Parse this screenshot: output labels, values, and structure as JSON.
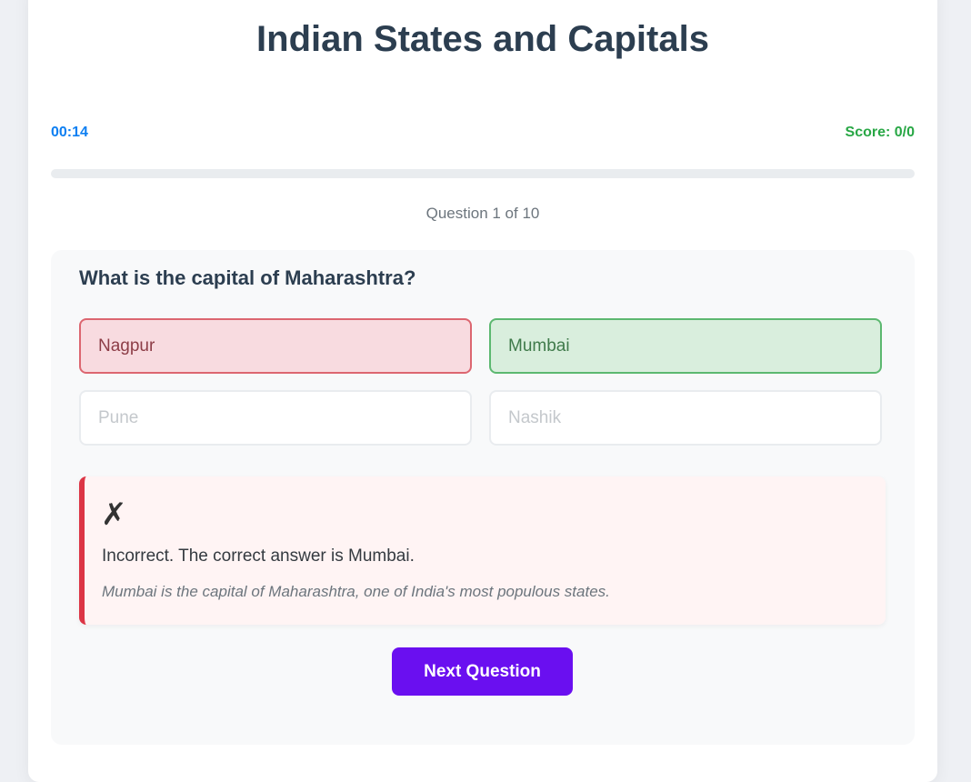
{
  "quiz": {
    "title": "Indian States and Capitals",
    "timer": "00:14",
    "score": "Score: 0/0",
    "progress": 0,
    "counter": "Question 1 of 10"
  },
  "question": {
    "text": "What is the capital of Maharashtra?",
    "options": [
      {
        "label": "Nagpur",
        "state": "incorrect"
      },
      {
        "label": "Mumbai",
        "state": "correct"
      },
      {
        "label": "Pune",
        "state": "disabled"
      },
      {
        "label": "Nashik",
        "state": "disabled"
      }
    ]
  },
  "feedback": {
    "icon": "✗",
    "icon_name": "cross-mark-icon",
    "message": "Incorrect. The correct answer is Mumbai.",
    "explanation": "Mumbai is the capital of Maharashtra, one of India's most populous states."
  },
  "actions": {
    "next_label": "Next Question"
  },
  "colors": {
    "timer": "#0d7ff2",
    "score": "#28a745",
    "accent": "#6a0ff0",
    "incorrect": "#dc3545",
    "correct": "#28a745"
  }
}
